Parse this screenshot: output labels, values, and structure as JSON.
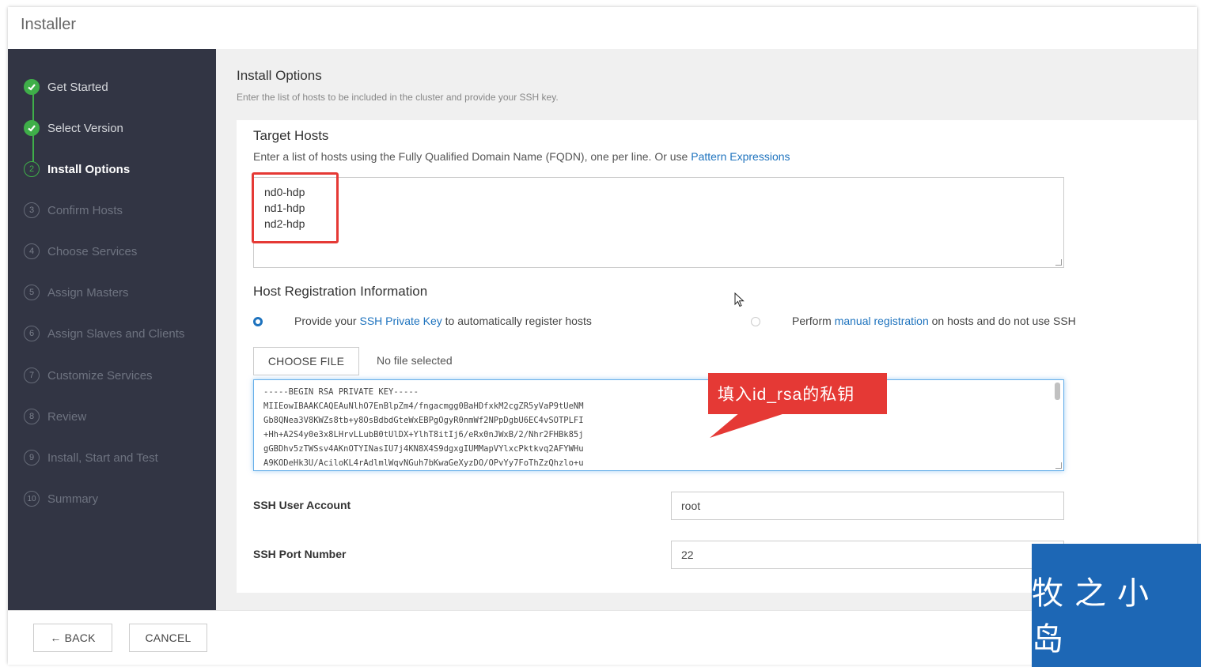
{
  "window": {
    "title": "Installer"
  },
  "sidebar": {
    "steps": [
      {
        "number": "1",
        "label": "Get Started",
        "state": "done"
      },
      {
        "number": "2",
        "label": "Select Version",
        "state": "done"
      },
      {
        "number": "2",
        "label": "Install Options",
        "state": "current"
      },
      {
        "number": "3",
        "label": "Confirm Hosts",
        "state": "pending"
      },
      {
        "number": "4",
        "label": "Choose Services",
        "state": "pending"
      },
      {
        "number": "5",
        "label": "Assign Masters",
        "state": "pending"
      },
      {
        "number": "6",
        "label": "Assign Slaves and Clients",
        "state": "pending"
      },
      {
        "number": "7",
        "label": "Customize Services",
        "state": "pending"
      },
      {
        "number": "8",
        "label": "Review",
        "state": "pending"
      },
      {
        "number": "9",
        "label": "Install, Start and Test",
        "state": "pending"
      },
      {
        "number": "10",
        "label": "Summary",
        "state": "pending"
      }
    ]
  },
  "main": {
    "title": "Install Options",
    "subtitle": "Enter the list of hosts to be included in the cluster and provide your SSH key.",
    "target_hosts": {
      "heading": "Target Hosts",
      "desc_prefix": "Enter a list of hosts using the Fully Qualified Domain Name (FQDN), one per line. Or use ",
      "desc_link": "Pattern Expressions",
      "hosts": [
        "nd0-hdp",
        "nd1-hdp",
        "nd2-hdp"
      ]
    },
    "registration": {
      "heading": "Host Registration Information",
      "option_ssh_prefix": "Provide your ",
      "option_ssh_link": "SSH Private Key",
      "option_ssh_suffix": " to automatically register hosts",
      "option_manual_prefix": "Perform ",
      "option_manual_link": "manual registration",
      "option_manual_suffix": " on hosts and do not use SSH",
      "choose_file_label": "CHOOSE FILE",
      "no_file_text": "No file selected",
      "key_lines": [
        "-----BEGIN RSA PRIVATE KEY-----",
        "MIIEowIBAAKCAQEAuNlhO7EnBlpZm4/fngacmgg0BaHDfxkM2cgZR5yVaP9tUeNM",
        "Gb8QNea3V8KWZs8tb+y8OsBdbdGteWxEBPgOgyR0nmWf2NPpDgbU6EC4vSOTPLFI",
        "+Hh+A2S4y0e3x8LHrvLLubB0tUlDX+YlhT8itIj6/eRx0nJWxB/2/Nhr2FHBk85j",
        "gGBDhv5zTWSsv4AKnOTYINasIU7j4KN8X4S9dgxgIUMMapVYlxcPktkvq2AFYWHu",
        "A9KODeHk3U/AciloKL4rAdlmlWqvNGuh7bKwaGeXyzDO/OPvYy7FoThZzQhzlo+u"
      ],
      "ssh_user_label": "SSH User Account",
      "ssh_user_value": "root",
      "ssh_port_label": "SSH Port Number",
      "ssh_port_value": "22"
    }
  },
  "footer": {
    "back_label": "← BACK",
    "cancel_label": "CANCEL"
  },
  "annotation": {
    "callout_text": "填入id_rsa的私钥"
  },
  "watermark": {
    "text": "牧之小岛"
  },
  "colors": {
    "accent": "#3fae49",
    "link": "#1e73be",
    "sidebar_bg": "#323544",
    "callout": "#e53935",
    "watermark_bg": "#1d67b5"
  }
}
